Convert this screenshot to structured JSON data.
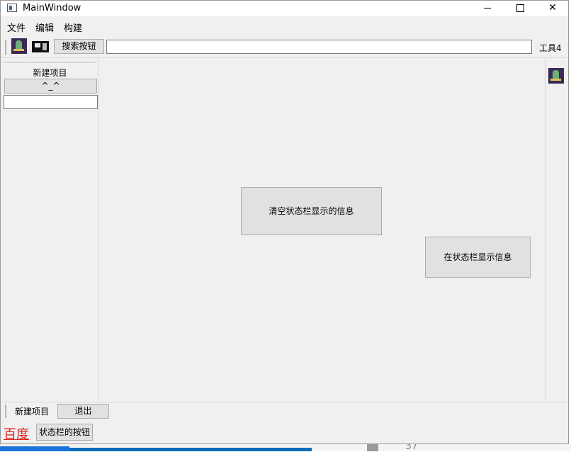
{
  "window": {
    "title": "MainWindow",
    "controls": {
      "minimize": "—",
      "maximize": "□",
      "close": "✕"
    }
  },
  "menubar": {
    "items": [
      "文件",
      "编辑",
      "构建"
    ]
  },
  "toolbar": {
    "icons": [
      "monster-icon",
      "film-icon"
    ],
    "search_button": "搜索按钮",
    "search_value": "",
    "tool4_label": "工具4"
  },
  "dock_left": {
    "label": "新建项目",
    "button_label": "^_^",
    "input_value": ""
  },
  "dock_right": {
    "icons": [
      "monster-icon"
    ]
  },
  "central": {
    "clear_status_button": "清空状态栏显示的信息",
    "show_status_button": "在状态栏显示信息"
  },
  "bottom_toolbar": {
    "new_project_label": "新建项目",
    "exit_button": "退出"
  },
  "statusbar": {
    "link_text": "百度",
    "button_label": "状态栏的按钮",
    "link_color": "#e02020"
  },
  "background": {
    "taskbar_number": "37"
  }
}
